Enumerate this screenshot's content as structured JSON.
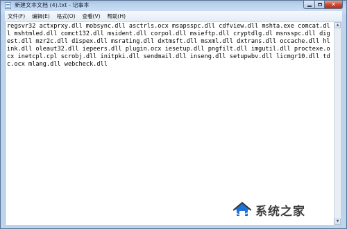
{
  "window": {
    "title": "新建文本文档 (4).txt - 记事本"
  },
  "menu": {
    "items": [
      {
        "label": "文件(F)"
      },
      {
        "label": "编辑(E)"
      },
      {
        "label": "格式(O)"
      },
      {
        "label": "查看(V)"
      },
      {
        "label": "帮助(H)"
      }
    ]
  },
  "editor": {
    "content": "regsvr32 actxprxy.dll mobsync.dll asctrls.ocx msapsspc.dll cdfview.dll mshta.exe comcat.dll mshtmled.dll comct132.dll msident.dll corpol.dll msieftp.dll cryptdlg.dl msnsspc.dll digest.dll mzr2c.dll dispex.dll msrating.dll dxtmsft.dll msxml.dll dxtrans.dll occache.dll hlink.dll oleaut32.dll iepeers.dll plugin.ocx iesetup.dll pngfilt.dll imgutil.dll proctexe.ocx inetcpl.cpl scrobj.dll initpki.dll sendmail.dll inseng.dll setupwbv.dll licmgr10.dll tdc.ocx mlang.dll webcheck.dll"
  },
  "watermark": {
    "logo_icon": "house-logo-icon",
    "text": "系统之家",
    "colors": {
      "logo_blue": "#1e73d8",
      "logo_dark": "#333333"
    }
  },
  "colors": {
    "titlebar": "#bcd3ee",
    "close_button": "#c7462f",
    "menubar": "#eef3fa",
    "editor_bg": "#ffffff"
  }
}
